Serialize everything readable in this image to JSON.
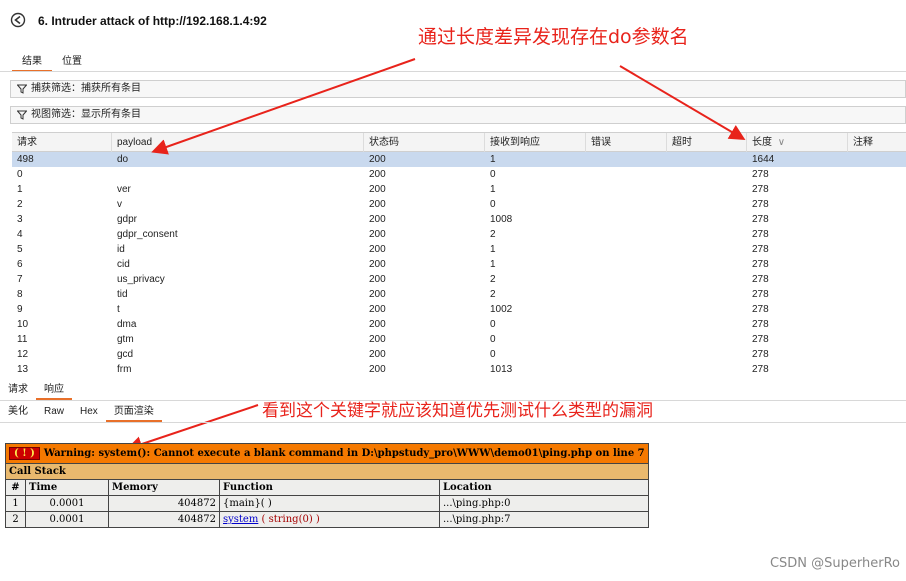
{
  "window": {
    "title": "6. Intruder attack of http://192.168.1.4:92"
  },
  "top_tabs": [
    {
      "label": "结果",
      "active": true
    },
    {
      "label": "位置",
      "active": false
    }
  ],
  "filters": {
    "capture": "捕获筛选：捕获所有条目",
    "view": "视图筛选：显示所有条目"
  },
  "results_table": {
    "columns": [
      "请求",
      "payload",
      "状态码",
      "接收到响应",
      "错误",
      "超时",
      "长度",
      "注释"
    ],
    "sort_indicator": "∨",
    "rows": [
      {
        "request": "498",
        "payload": "do",
        "status": "200",
        "received": "1",
        "length": "1644",
        "selected": true
      },
      {
        "request": "0",
        "payload": "",
        "status": "200",
        "received": "0",
        "length": "278"
      },
      {
        "request": "1",
        "payload": "ver",
        "status": "200",
        "received": "1",
        "length": "278"
      },
      {
        "request": "2",
        "payload": "v",
        "status": "200",
        "received": "0",
        "length": "278"
      },
      {
        "request": "3",
        "payload": "gdpr",
        "status": "200",
        "received": "1008",
        "length": "278"
      },
      {
        "request": "4",
        "payload": "gdpr_consent",
        "status": "200",
        "received": "2",
        "length": "278"
      },
      {
        "request": "5",
        "payload": "id",
        "status": "200",
        "received": "1",
        "length": "278"
      },
      {
        "request": "6",
        "payload": "cid",
        "status": "200",
        "received": "1",
        "length": "278"
      },
      {
        "request": "7",
        "payload": "us_privacy",
        "status": "200",
        "received": "2",
        "length": "278"
      },
      {
        "request": "8",
        "payload": "tid",
        "status": "200",
        "received": "2",
        "length": "278"
      },
      {
        "request": "9",
        "payload": "t",
        "status": "200",
        "received": "1002",
        "length": "278"
      },
      {
        "request": "10",
        "payload": "dma",
        "status": "200",
        "received": "0",
        "length": "278"
      },
      {
        "request": "11",
        "payload": "gtm",
        "status": "200",
        "received": "0",
        "length": "278"
      },
      {
        "request": "12",
        "payload": "gcd",
        "status": "200",
        "received": "0",
        "length": "278"
      },
      {
        "request": "13",
        "payload": "frm",
        "status": "200",
        "received": "1013",
        "length": "278"
      }
    ]
  },
  "annotations": {
    "top": "通过长度差异发现存在do参数名",
    "bottom": "看到这个关键字就应该知道优先测试什么类型的漏洞"
  },
  "message_tabs": [
    {
      "label": "请求",
      "active": false
    },
    {
      "label": "响应",
      "active": true
    }
  ],
  "view_tabs": [
    {
      "label": "美化",
      "active": false
    },
    {
      "label": "Raw",
      "active": false
    },
    {
      "label": "Hex",
      "active": false
    },
    {
      "label": "页面渲染",
      "active": true
    }
  ],
  "xdebug": {
    "bang": "( ! )",
    "warning": "Warning: system(): Cannot execute a blank command in D:\\phpstudy_pro\\WWW\\demo01\\ping.php on line 7",
    "call_stack": "Call Stack",
    "headers": [
      "#",
      "Time",
      "Memory",
      "Function",
      "Location"
    ],
    "rows": [
      {
        "num": "1",
        "time": "0.0001",
        "memory": "404872",
        "func": "{main}( )",
        "location": "...\\ping.php:0"
      },
      {
        "num": "2",
        "time": "0.0001",
        "memory": "404872",
        "func_name": "system",
        "func_args": "( string(0) )",
        "location": "...\\ping.php:7"
      }
    ]
  },
  "watermark": "CSDN @SuperherRo",
  "colors": {
    "accent": "#e8702a",
    "annotation": "#e8231b",
    "selected_row": "#c9d9ee",
    "xdebug_warning": "#f57900",
    "xdebug_stack": "#e9b96e"
  }
}
